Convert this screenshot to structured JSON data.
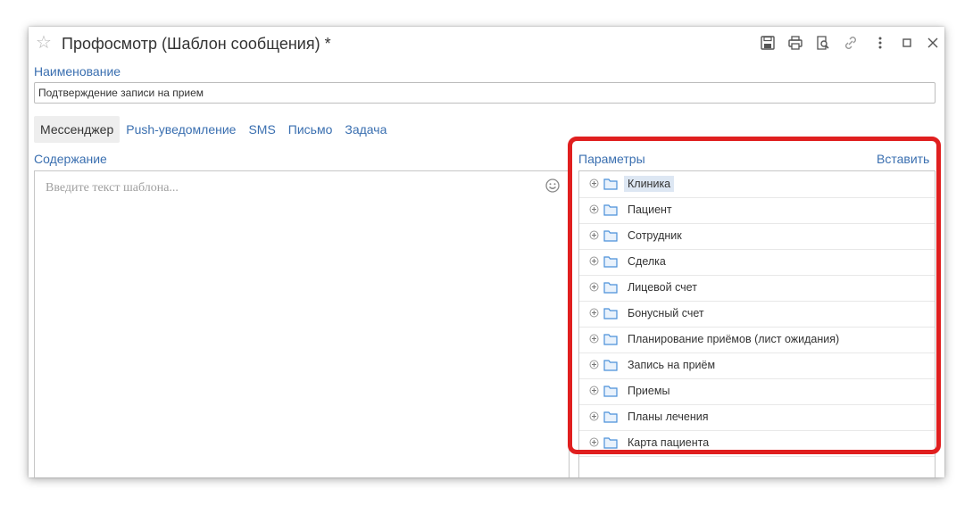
{
  "window": {
    "title": "Профосмотр (Шаблон сообщения) *"
  },
  "form": {
    "name_label": "Наименование",
    "name_value": "Подтверждение записи на прием",
    "tabs": [
      {
        "label": "Мессенджер",
        "active": true
      },
      {
        "label": "Push-уведомление",
        "active": false
      },
      {
        "label": "SMS",
        "active": false
      },
      {
        "label": "Письмо",
        "active": false
      },
      {
        "label": "Задача",
        "active": false
      }
    ],
    "content_label": "Содержание",
    "content_placeholder": "Введите текст шаблона..."
  },
  "params": {
    "label": "Параметры",
    "insert_label": "Вставить",
    "items": [
      {
        "label": "Клиника",
        "selected": true
      },
      {
        "label": "Пациент"
      },
      {
        "label": "Сотрудник"
      },
      {
        "label": "Сделка"
      },
      {
        "label": "Лицевой счет"
      },
      {
        "label": "Бонусный счет"
      },
      {
        "label": "Планирование приёмов (лист ожидания)"
      },
      {
        "label": "Запись на приём"
      },
      {
        "label": "Приемы"
      },
      {
        "label": "Планы лечения"
      },
      {
        "label": "Карта пациента"
      }
    ]
  },
  "colors": {
    "link": "#3a6fb0",
    "highlight": "#e01f1f",
    "folder": "#4a90d9"
  }
}
